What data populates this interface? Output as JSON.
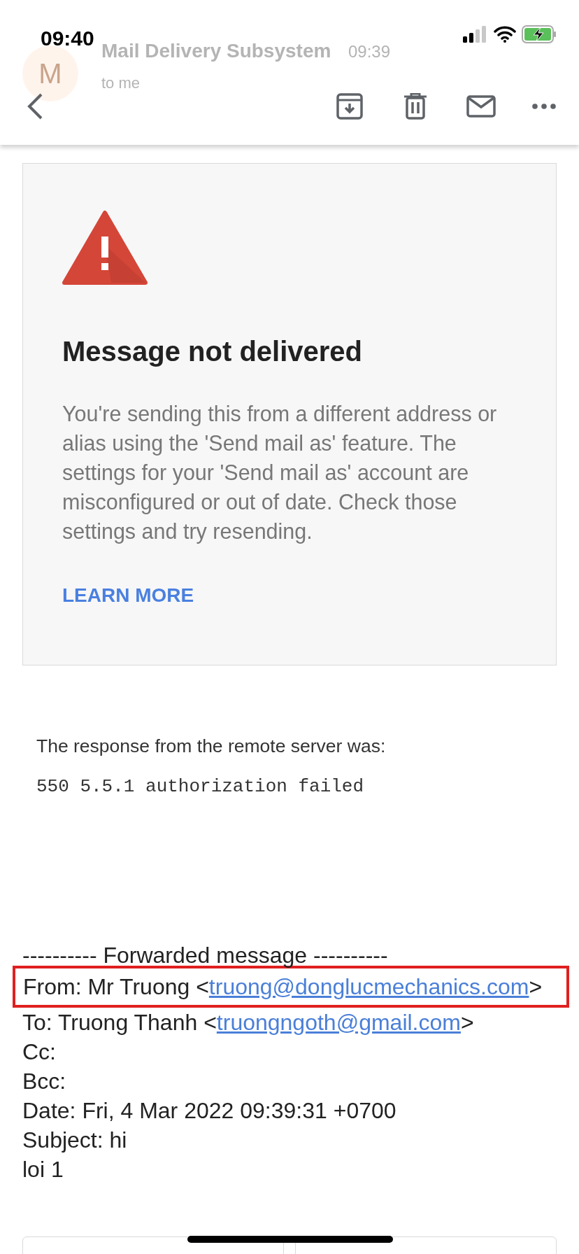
{
  "status_bar": {
    "time": "09:40"
  },
  "faded_header": {
    "sender": "Mail Delivery Subsystem",
    "time": "09:39",
    "recipient": "to me",
    "avatar_letter": "M"
  },
  "error_card": {
    "title": "Message not delivered",
    "body": "You're sending this from a different address or alias using the 'Send mail as' feature. The settings for your 'Send mail as' account are misconfigured or out of date. Check those settings and try resending.",
    "link": "LEARN MORE"
  },
  "server_response": {
    "intro": "The response from the remote server was:",
    "code": "550 5.5.1 authorization failed"
  },
  "forwarded": {
    "separator": "---------- Forwarded message ----------",
    "lines": [
      {
        "label": "From: Mr Truong <",
        "link": "truong@donglucmechanics.com",
        "suffix": ">",
        "highlighted": true
      },
      {
        "label": "To: Truong Thanh <",
        "link": "truongngoth@gmail.com",
        "suffix": ">",
        "highlighted": false
      },
      {
        "label": "Cc:",
        "highlighted": false
      },
      {
        "label": "Bcc:",
        "highlighted": false
      },
      {
        "label": "Date: Fri, 4 Mar 2022 09:39:31 +0700",
        "highlighted": false
      },
      {
        "label": "Subject: hi",
        "highlighted": false
      },
      {
        "label": "loi 1",
        "highlighted": false
      }
    ]
  }
}
